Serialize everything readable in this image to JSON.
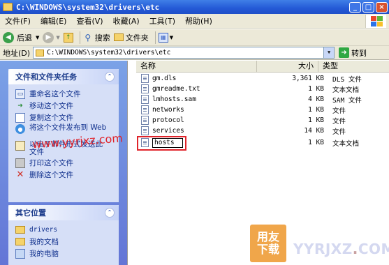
{
  "window": {
    "title": "C:\\WINDOWS\\system32\\drivers\\etc",
    "min": "_",
    "max": "□",
    "close": "×"
  },
  "menu": [
    "文件(F)",
    "编辑(E)",
    "查看(V)",
    "收藏(A)",
    "工具(T)",
    "帮助(H)"
  ],
  "toolbar": {
    "back": "后退",
    "search": "搜索",
    "folders": "文件夹"
  },
  "address": {
    "label": "地址(D)",
    "value": "C:\\WINDOWS\\system32\\drivers\\etc",
    "go": "转到"
  },
  "tasks": {
    "title": "文件和文件夹任务",
    "items": [
      "重命名这个文件",
      "移动这个文件",
      "复制这个文件",
      "将这个文件发布到 Web",
      "以电子邮件形式发送此文件",
      "打印这个文件",
      "删除这个文件"
    ]
  },
  "places": {
    "title": "其它位置",
    "items": [
      "drivers",
      "我的文档",
      "我的电脑"
    ]
  },
  "columns": {
    "name": "名称",
    "size": "大小",
    "type": "类型"
  },
  "files": [
    {
      "name": "gm.dls",
      "size": "3,361 KB",
      "type": "DLS 文件"
    },
    {
      "name": "gmreadme.txt",
      "size": "1 KB",
      "type": "文本文档"
    },
    {
      "name": "lmhosts.sam",
      "size": "4 KB",
      "type": "SAM 文件"
    },
    {
      "name": "networks",
      "size": "1 KB",
      "type": "文件"
    },
    {
      "name": "protocol",
      "size": "1 KB",
      "type": "文件"
    },
    {
      "name": "services",
      "size": "14 KB",
      "type": "文件"
    },
    {
      "name": "hosts",
      "size": "1 KB",
      "type": "文本文档"
    }
  ],
  "watermark": "www.yyrjxz.com",
  "logo": {
    "line1": "用友",
    "line2": "下载",
    "text": "YYRJXZ",
    "dot": ".",
    "suffix": "COM"
  }
}
